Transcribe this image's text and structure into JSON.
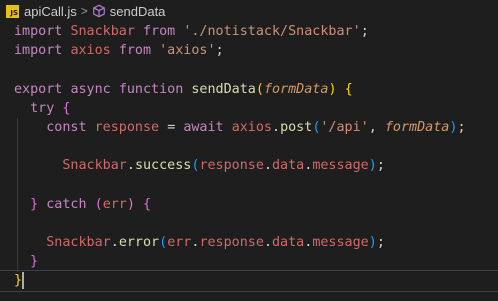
{
  "breadcrumb": {
    "file_icon_text": "JS",
    "file_name": "apiCall.js",
    "separator": ">",
    "symbol": "sendData"
  },
  "code": {
    "l1": {
      "t1": "import",
      "t2": "Snackbar",
      "t3": "from",
      "t4": "'./notistack/Snackbar'",
      "t5": ";"
    },
    "l2": {
      "t1": "import",
      "t2": "axios",
      "t3": "from",
      "t4": "'axios'",
      "t5": ";"
    },
    "l4": {
      "t1": "export",
      "t2": "async",
      "t3": "function",
      "t4": "sendData",
      "t5": "(",
      "t6": "formData",
      "t7": ")",
      "t8": "{"
    },
    "l5": {
      "t1": "try",
      "t2": "{"
    },
    "l6": {
      "t1": "const",
      "t2": "response",
      "t3": "=",
      "t4": "await",
      "t5": "axios",
      "t6": ".",
      "t7": "post",
      "t8": "(",
      "t9": "'/api'",
      "t10": ", ",
      "t11": "formData",
      "t12": ")",
      "t13": ";"
    },
    "l8": {
      "t1": "Snackbar",
      "t2": ".",
      "t3": "success",
      "t4": "(",
      "t5": "response",
      "t6": ".",
      "t7": "data",
      "t8": ".",
      "t9": "message",
      "t10": ")",
      "t11": ";"
    },
    "l10": {
      "t1": "}",
      "t2": "catch",
      "t3": "(",
      "t4": "err",
      "t5": ")",
      "t6": "{"
    },
    "l12": {
      "t1": "Snackbar",
      "t2": ".",
      "t3": "error",
      "t4": "(",
      "t5": "err",
      "t6": ".",
      "t7": "response",
      "t8": ".",
      "t9": "data",
      "t10": ".",
      "t11": "message",
      "t12": ")",
      "t13": ";"
    },
    "l13": {
      "t1": "}"
    },
    "l14": {
      "t1": "}"
    }
  },
  "colors": {
    "background": "#1e1e1e",
    "keyword": "#c586c0",
    "string": "#ce9178",
    "function": "#dcdcaa",
    "parameter": "#d19a66",
    "bracket_level1": "#ffd700",
    "bracket_level2": "#da70d6",
    "bracket_level3": "#179fff"
  },
  "icons": {
    "file": "javascript-file-icon",
    "symbol": "function-cube-icon"
  }
}
